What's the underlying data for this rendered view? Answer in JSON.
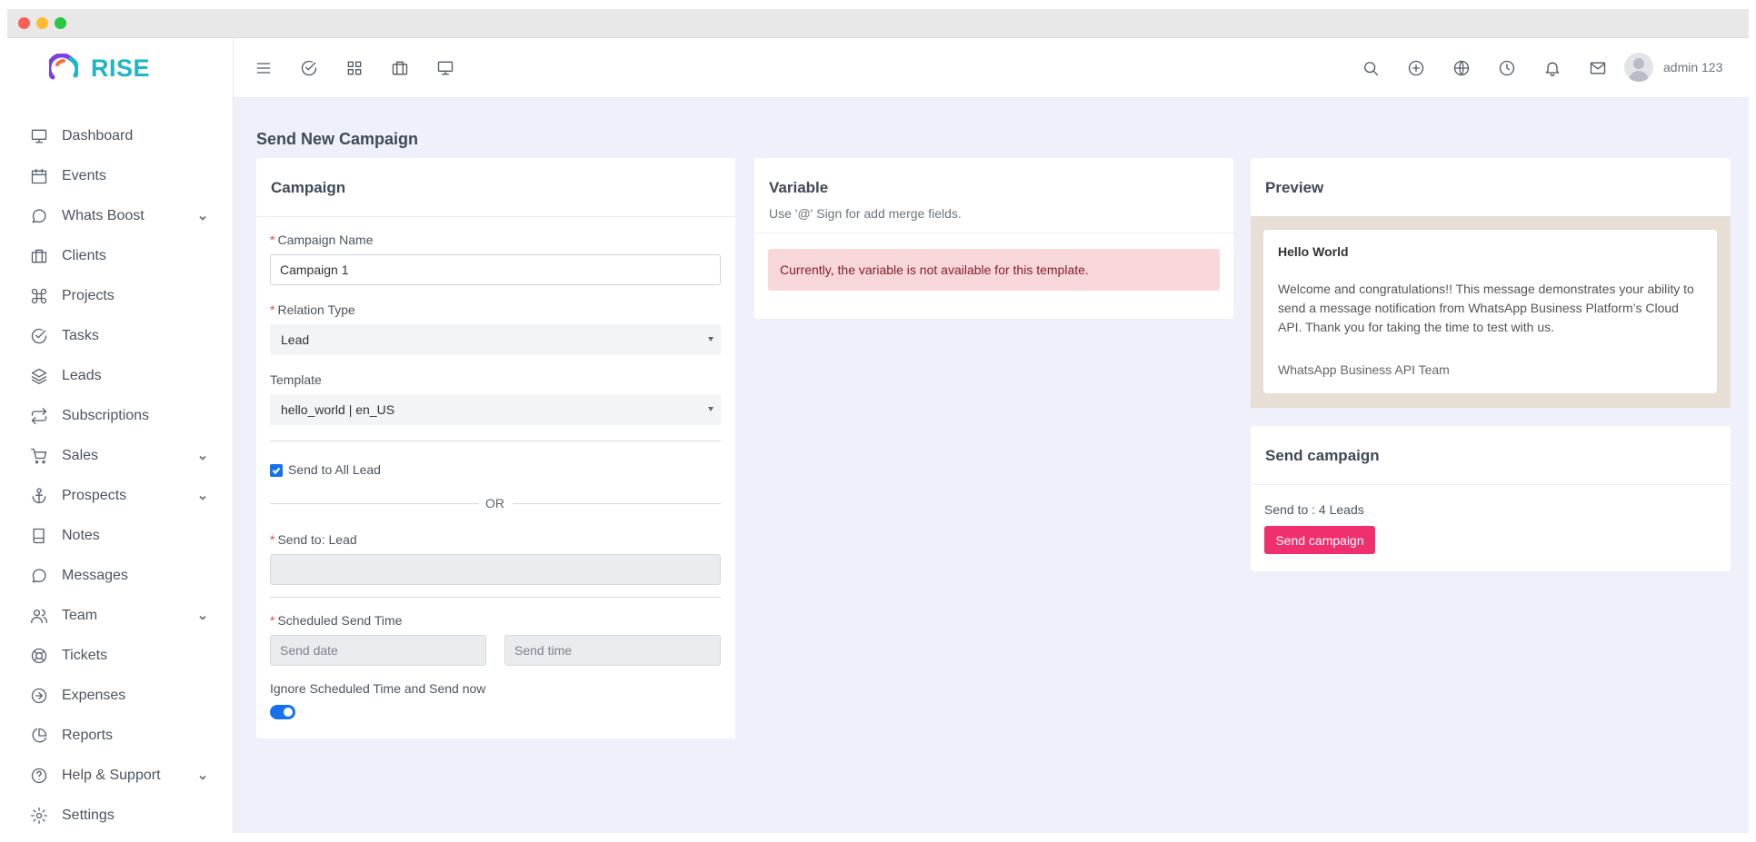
{
  "brand": {
    "name": "RISE",
    "accent": "#1fb5c7"
  },
  "sidebar": {
    "items": [
      {
        "label": "Dashboard",
        "icon": "monitor-icon",
        "has_submenu": false
      },
      {
        "label": "Events",
        "icon": "calendar-icon",
        "has_submenu": false
      },
      {
        "label": "Whats Boost",
        "icon": "chat-bubble-icon",
        "has_submenu": true
      },
      {
        "label": "Clients",
        "icon": "briefcase-icon",
        "has_submenu": false
      },
      {
        "label": "Projects",
        "icon": "command-icon",
        "has_submenu": false
      },
      {
        "label": "Tasks",
        "icon": "check-circle-icon",
        "has_submenu": false
      },
      {
        "label": "Leads",
        "icon": "layers-icon",
        "has_submenu": false
      },
      {
        "label": "Subscriptions",
        "icon": "repeat-icon",
        "has_submenu": false
      },
      {
        "label": "Sales",
        "icon": "cart-icon",
        "has_submenu": true
      },
      {
        "label": "Prospects",
        "icon": "anchor-icon",
        "has_submenu": true
      },
      {
        "label": "Notes",
        "icon": "book-icon",
        "has_submenu": false
      },
      {
        "label": "Messages",
        "icon": "message-circle-icon",
        "has_submenu": false
      },
      {
        "label": "Team",
        "icon": "users-icon",
        "has_submenu": true
      },
      {
        "label": "Tickets",
        "icon": "life-buoy-icon",
        "has_submenu": false
      },
      {
        "label": "Expenses",
        "icon": "arrow-right-circle-icon",
        "has_submenu": false
      },
      {
        "label": "Reports",
        "icon": "pie-chart-icon",
        "has_submenu": false
      },
      {
        "label": "Help & Support",
        "icon": "help-circle-icon",
        "has_submenu": true
      },
      {
        "label": "Settings",
        "icon": "settings-icon",
        "has_submenu": false
      }
    ]
  },
  "topbar": {
    "left_icons": [
      "menu-icon",
      "check-circle-icon",
      "grid-icon",
      "briefcase-icon",
      "monitor-icon"
    ],
    "right_icons": [
      "search-icon",
      "plus-circle-icon",
      "globe-icon",
      "clock-icon",
      "bell-icon",
      "mail-icon"
    ],
    "username": "admin 123"
  },
  "page": {
    "title": "Send New Campaign"
  },
  "campaign_card": {
    "title": "Campaign",
    "campaign_name_label": "Campaign Name",
    "campaign_name_value": "Campaign 1",
    "relation_type_label": "Relation Type",
    "relation_type_value": "Lead",
    "template_label": "Template",
    "template_value": "hello_world | en_US",
    "send_all_label": "Send to All Lead",
    "send_all_checked": true,
    "or_text": "OR",
    "send_to_label": "Send to: Lead",
    "scheduled_label": "Scheduled Send Time",
    "send_date_placeholder": "Send date",
    "send_time_placeholder": "Send time",
    "ignore_label": "Ignore Scheduled Time and Send now",
    "ignore_enabled": true
  },
  "variable_card": {
    "title": "Variable",
    "subtitle": "Use '@' Sign for add merge fields.",
    "alert": "Currently, the variable is not available for this template."
  },
  "preview_card": {
    "title": "Preview",
    "message_header": "Hello World",
    "message_body": "Welcome and congratulations!! This message demonstrates your ability to send a message notification from WhatsApp Business Platform’s Cloud API. Thank you for taking the time to test with us.",
    "message_footer": "WhatsApp Business API Team"
  },
  "send_card": {
    "title": "Send campaign",
    "send_to_text": "Send to : 4 Leads",
    "button_label": "Send campaign",
    "button_color": "#f0306e"
  }
}
